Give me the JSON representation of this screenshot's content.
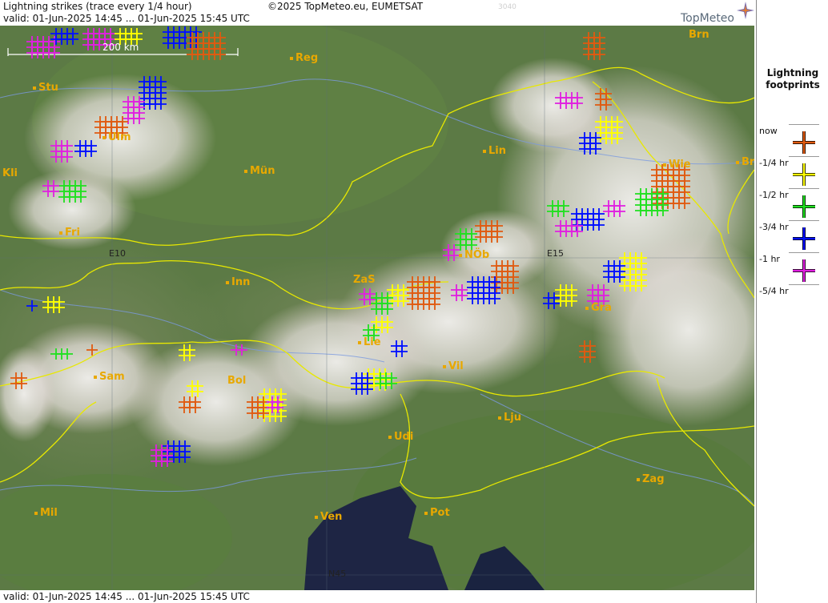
{
  "header": {
    "title": "Lightning strikes (trace every 1/4 hour)",
    "valid_top": "valid:  01-Jun-2025 14:45 ... 01-Jun-2025 15:45 UTC",
    "copyright": "©2025 TopMeteo.eu, EUMETSAT",
    "faint_code": "3040",
    "logo": "TopMeteo"
  },
  "footer": {
    "valid_bottom": "valid:  01-Jun-2025 14:45 ... 01-Jun-2025 15:45 UTC"
  },
  "map": {
    "scale_label": "200 km",
    "cities": [
      "Brn",
      "Reg",
      "Stu",
      "Ulm",
      "Lin",
      "Wie",
      "Br",
      "Kli",
      "Mün",
      "Fri",
      "E10",
      "E15",
      "NÖb",
      "Inn",
      "ZaS",
      "Gra",
      "Lie",
      "Vil",
      "Sam",
      "Bol",
      "Lju",
      "Udi",
      "Zag",
      "Mil",
      "Ven",
      "Pot",
      "N45"
    ]
  },
  "legend": {
    "title_line1": "Lightning",
    "title_line2": "footprints",
    "entries": [
      {
        "label": "now",
        "color": "#e05a10"
      },
      {
        "label": "-1/4 hr",
        "color": "#ffff00"
      },
      {
        "label": "-1/2 hr",
        "color": "#20e020"
      },
      {
        "label": "-3/4 hr",
        "color": "#0010ff"
      },
      {
        "label": "-1 hr",
        "color": "#e020e0"
      },
      {
        "label": "-5/4 hr",
        "color": ""
      }
    ]
  },
  "colors": {
    "now": "#e05a10",
    "q1": "#ffff00",
    "q2": "#20e020",
    "q3": "#0010ff",
    "q4": "#e020e0",
    "border": "#e8e800",
    "city": "#e8a800",
    "river": "#7a9ae0"
  }
}
